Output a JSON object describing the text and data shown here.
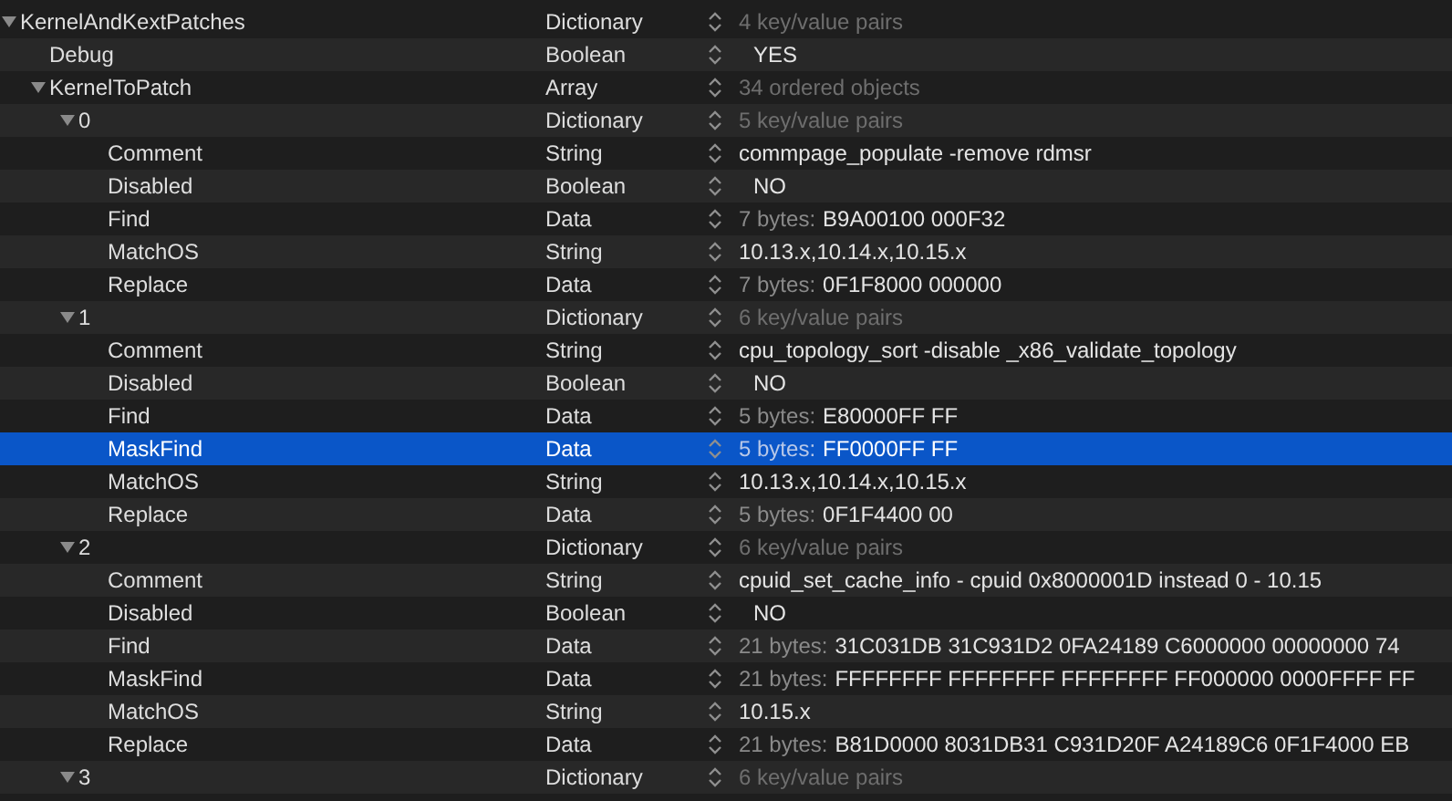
{
  "rows": [
    {
      "key": "KernelAndKextPatches",
      "type": "Dictionary",
      "kind": "container",
      "summary": "4 key/value pairs",
      "expanded": true,
      "selected": false,
      "children": [
        {
          "key": "Debug",
          "type": "Boolean",
          "kind": "boolean",
          "value": "YES",
          "selected": false
        },
        {
          "key": "KernelToPatch",
          "type": "Array",
          "kind": "container",
          "summary": "34 ordered objects",
          "expanded": true,
          "selected": false,
          "children": [
            {
              "key": "0",
              "type": "Dictionary",
              "kind": "container",
              "summary": "5 key/value pairs",
              "expanded": true,
              "selected": false,
              "children": [
                {
                  "key": "Comment",
                  "type": "String",
                  "kind": "string",
                  "value": "commpage_populate -remove rdmsr",
                  "selected": false
                },
                {
                  "key": "Disabled",
                  "type": "Boolean",
                  "kind": "boolean",
                  "value": "NO",
                  "selected": false
                },
                {
                  "key": "Find",
                  "type": "Data",
                  "kind": "data",
                  "size": "7 bytes:",
                  "value": "B9A00100 000F32",
                  "selected": false
                },
                {
                  "key": "MatchOS",
                  "type": "String",
                  "kind": "string",
                  "value": "10.13.x,10.14.x,10.15.x",
                  "selected": false
                },
                {
                  "key": "Replace",
                  "type": "Data",
                  "kind": "data",
                  "size": "7 bytes:",
                  "value": "0F1F8000 000000",
                  "selected": false
                }
              ]
            },
            {
              "key": "1",
              "type": "Dictionary",
              "kind": "container",
              "summary": "6 key/value pairs",
              "expanded": true,
              "selected": false,
              "children": [
                {
                  "key": "Comment",
                  "type": "String",
                  "kind": "string",
                  "value": "cpu_topology_sort -disable _x86_validate_topology",
                  "selected": false
                },
                {
                  "key": "Disabled",
                  "type": "Boolean",
                  "kind": "boolean",
                  "value": "NO",
                  "selected": false
                },
                {
                  "key": "Find",
                  "type": "Data",
                  "kind": "data",
                  "size": "5 bytes:",
                  "value": "E80000FF FF",
                  "selected": false
                },
                {
                  "key": "MaskFind",
                  "type": "Data",
                  "kind": "data",
                  "size": "5 bytes:",
                  "value": "FF0000FF FF",
                  "selected": true
                },
                {
                  "key": "MatchOS",
                  "type": "String",
                  "kind": "string",
                  "value": "10.13.x,10.14.x,10.15.x",
                  "selected": false
                },
                {
                  "key": "Replace",
                  "type": "Data",
                  "kind": "data",
                  "size": "5 bytes:",
                  "value": "0F1F4400 00",
                  "selected": false
                }
              ]
            },
            {
              "key": "2",
              "type": "Dictionary",
              "kind": "container",
              "summary": "6 key/value pairs",
              "expanded": true,
              "selected": false,
              "children": [
                {
                  "key": "Comment",
                  "type": "String",
                  "kind": "string",
                  "value": "cpuid_set_cache_info - cpuid 0x8000001D instead 0 - 10.15",
                  "selected": false
                },
                {
                  "key": "Disabled",
                  "type": "Boolean",
                  "kind": "boolean",
                  "value": "NO",
                  "selected": false
                },
                {
                  "key": "Find",
                  "type": "Data",
                  "kind": "data",
                  "size": "21 bytes:",
                  "value": "31C031DB 31C931D2 0FA24189 C6000000 00000000 74",
                  "selected": false
                },
                {
                  "key": "MaskFind",
                  "type": "Data",
                  "kind": "data",
                  "size": "21 bytes:",
                  "value": "FFFFFFFF FFFFFFFF FFFFFFFF FF000000 0000FFFF FF",
                  "selected": false
                },
                {
                  "key": "MatchOS",
                  "type": "String",
                  "kind": "string",
                  "value": "10.15.x",
                  "selected": false
                },
                {
                  "key": "Replace",
                  "type": "Data",
                  "kind": "data",
                  "size": "21 bytes:",
                  "value": "B81D0000 8031DB31 C931D20F A24189C6 0F1F4000 EB",
                  "selected": false
                }
              ]
            },
            {
              "key": "3",
              "type": "Dictionary",
              "kind": "container",
              "summary": "6 key/value pairs",
              "expanded": true,
              "selected": false
            }
          ]
        }
      ]
    }
  ]
}
